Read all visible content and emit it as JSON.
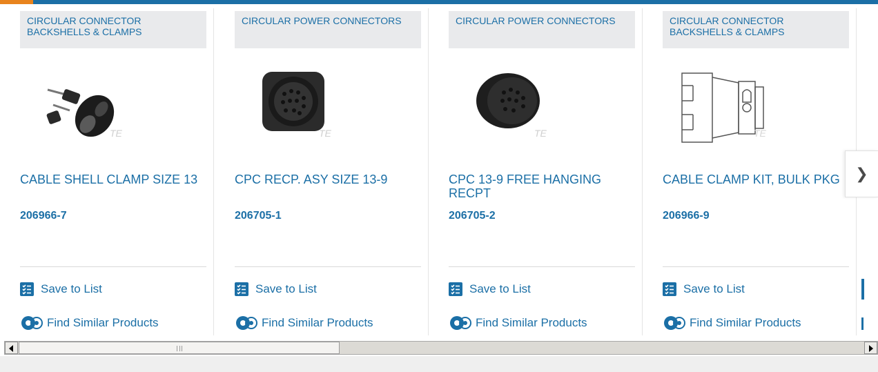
{
  "carousel": {
    "cards": [
      {
        "category": "CIRCULAR CONNECTOR BACKSHELLS & CLAMPS",
        "title": "CABLE SHELL CLAMP SIZE 13",
        "part_number": "206966-7",
        "image_icon": "cable-clamp-kit-photo",
        "save_label": "Save to List",
        "similar_label": "Find Similar Products"
      },
      {
        "category": "CIRCULAR POWER CONNECTORS",
        "title": "CPC RECP. ASY SIZE 13-9",
        "part_number": "206705-1",
        "image_icon": "flange-receptacle-photo",
        "save_label": "Save to List",
        "similar_label": "Find Similar Products"
      },
      {
        "category": "CIRCULAR POWER CONNECTORS",
        "title": "CPC 13-9 FREE HANGING RECPT",
        "part_number": "206705-2",
        "image_icon": "free-hanging-receptacle-photo",
        "save_label": "Save to List",
        "similar_label": "Find Similar Products"
      },
      {
        "category": "CIRCULAR CONNECTOR BACKSHELLS & CLAMPS",
        "title": "CABLE CLAMP KIT, BULK PKG",
        "part_number": "206966-9",
        "image_icon": "cable-clamp-drawing",
        "save_label": "Save to List",
        "similar_label": "Find Similar Products"
      }
    ],
    "watermark": "TE",
    "next_icon": "chevron-right-icon"
  },
  "colors": {
    "brand_blue": "#1b6fa6",
    "accent_orange": "#e8831d",
    "category_bg": "#e9eaec"
  },
  "scrollbar": {
    "position_fraction": 0.0
  }
}
